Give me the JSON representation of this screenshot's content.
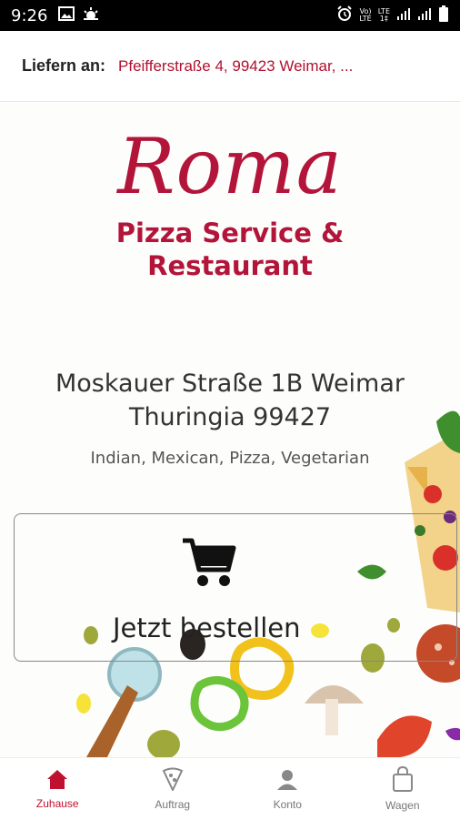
{
  "status_bar": {
    "time": "9:26",
    "icons_left": [
      "image-icon",
      "weather-icon"
    ],
    "icons_right": [
      "alarm-icon",
      "volte-icon",
      "lte-icon",
      "signal-icon",
      "signal-icon",
      "battery-icon"
    ],
    "volte_top": "Vo)",
    "volte_bottom": "LTE",
    "lte_top": "LTE",
    "lte_bottom": "1‡"
  },
  "delivery": {
    "label": "Liefern an:",
    "address": "Pfeifferstraße 4, 99423 Weimar, ..."
  },
  "restaurant": {
    "logo_name": "Roma",
    "logo_tagline_1": "Pizza Service &",
    "logo_tagline_2": "Restaurant",
    "address_line_1": "Moskauer Straße 1B Weimar",
    "address_line_2": "Thuringia 99427",
    "cuisines": "Indian, Mexican, Pizza, Vegetarian"
  },
  "order_button": {
    "label": "Jetzt bestellen",
    "icon": "shopping-cart-icon"
  },
  "bottom_nav": {
    "items": [
      {
        "label": "Zuhause",
        "icon": "home-icon",
        "active": true
      },
      {
        "label": "Auftrag",
        "icon": "pizza-icon",
        "active": false
      },
      {
        "label": "Konto",
        "icon": "user-icon",
        "active": false
      },
      {
        "label": "Wagen",
        "icon": "bag-icon",
        "active": false
      }
    ]
  },
  "colors": {
    "brand": "#b3143a",
    "active_nav": "#c0102f",
    "inactive_nav": "#777777"
  }
}
